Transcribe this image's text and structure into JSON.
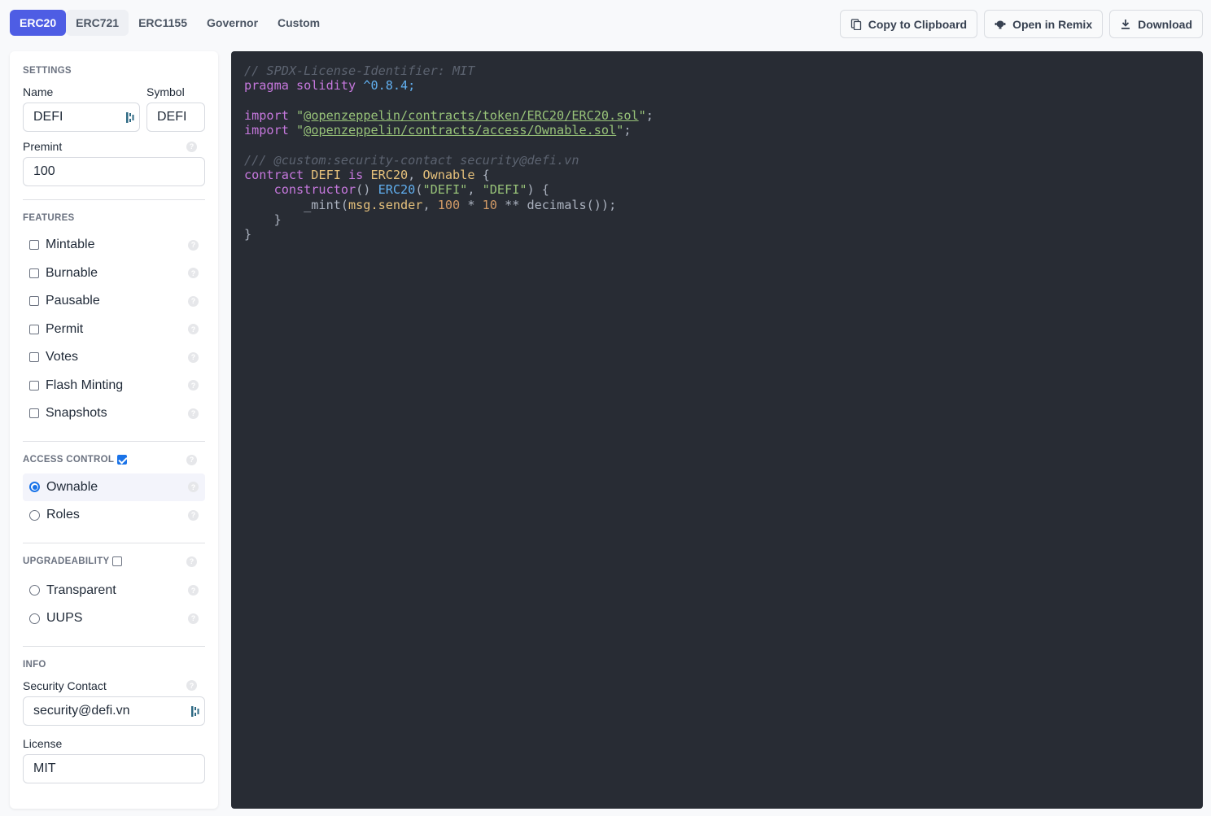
{
  "tabs": [
    {
      "label": "ERC20",
      "active": true
    },
    {
      "label": "ERC721",
      "active": false
    },
    {
      "label": "ERC1155",
      "active": false
    },
    {
      "label": "Governor",
      "active": false
    },
    {
      "label": "Custom",
      "active": false
    }
  ],
  "actions": {
    "copy": "Copy to Clipboard",
    "remix": "Open in Remix",
    "download": "Download"
  },
  "settings": {
    "title": "Settings",
    "name_label": "Name",
    "name_value": "DEFI",
    "symbol_label": "Symbol",
    "symbol_value": "DEFI",
    "premint_label": "Premint",
    "premint_value": "100"
  },
  "features": {
    "title": "Features",
    "items": [
      {
        "label": "Mintable",
        "checked": false
      },
      {
        "label": "Burnable",
        "checked": false
      },
      {
        "label": "Pausable",
        "checked": false
      },
      {
        "label": "Permit",
        "checked": false
      },
      {
        "label": "Votes",
        "checked": false
      },
      {
        "label": "Flash Minting",
        "checked": false
      },
      {
        "label": "Snapshots",
        "checked": false
      }
    ]
  },
  "access_control": {
    "title": "Access Control",
    "enabled": true,
    "options": [
      {
        "label": "Ownable",
        "selected": true
      },
      {
        "label": "Roles",
        "selected": false
      }
    ]
  },
  "upgradeability": {
    "title": "Upgradeability",
    "enabled": false,
    "options": [
      {
        "label": "Transparent",
        "selected": false
      },
      {
        "label": "UUPS",
        "selected": false
      }
    ]
  },
  "info": {
    "title": "Info",
    "security_label": "Security Contact",
    "security_value": "security@defi.vn",
    "license_label": "License",
    "license_value": "MIT"
  },
  "code": {
    "lines": [
      [
        {
          "t": "// SPDX-License-Identifier: MIT",
          "c": "comment"
        }
      ],
      [
        {
          "t": "pragma solidity ",
          "c": "kw"
        },
        {
          "t": "^0.8.4;",
          "c": "num"
        }
      ],
      [],
      [
        {
          "t": "import ",
          "c": "kw"
        },
        {
          "t": "\"",
          "c": "str"
        },
        {
          "t": "@openzeppelin/contracts/token/ERC20/ERC20.sol",
          "c": "link"
        },
        {
          "t": "\"",
          "c": "str"
        },
        {
          "t": ";",
          "c": "plain"
        }
      ],
      [
        {
          "t": "import ",
          "c": "kw"
        },
        {
          "t": "\"",
          "c": "str"
        },
        {
          "t": "@openzeppelin/contracts/access/Ownable.sol",
          "c": "link"
        },
        {
          "t": "\"",
          "c": "str"
        },
        {
          "t": ";",
          "c": "plain"
        }
      ],
      [],
      [
        {
          "t": "/// @custom:security-contact security@defi.vn",
          "c": "comment"
        }
      ],
      [
        {
          "t": "contract ",
          "c": "kw"
        },
        {
          "t": "DEFI",
          "c": "type"
        },
        {
          "t": " is ",
          "c": "kw"
        },
        {
          "t": "ERC20",
          "c": "type"
        },
        {
          "t": ", ",
          "c": "plain"
        },
        {
          "t": "Ownable",
          "c": "type"
        },
        {
          "t": " {",
          "c": "plain"
        }
      ],
      [
        {
          "t": "    constructor",
          "c": "kw"
        },
        {
          "t": "() ",
          "c": "plain"
        },
        {
          "t": "ERC20",
          "c": "fn"
        },
        {
          "t": "(",
          "c": "plain"
        },
        {
          "t": "\"DEFI\"",
          "c": "str"
        },
        {
          "t": ", ",
          "c": "plain"
        },
        {
          "t": "\"DEFI\"",
          "c": "str"
        },
        {
          "t": ") {",
          "c": "plain"
        }
      ],
      [
        {
          "t": "        _mint(",
          "c": "plain"
        },
        {
          "t": "msg.sender",
          "c": "type"
        },
        {
          "t": ", ",
          "c": "plain"
        },
        {
          "t": "100",
          "c": "lit"
        },
        {
          "t": " * ",
          "c": "plain"
        },
        {
          "t": "10",
          "c": "lit"
        },
        {
          "t": " ** decimals());",
          "c": "plain"
        }
      ],
      [
        {
          "t": "    }",
          "c": "plain"
        }
      ],
      [
        {
          "t": "}",
          "c": "plain"
        }
      ]
    ]
  }
}
